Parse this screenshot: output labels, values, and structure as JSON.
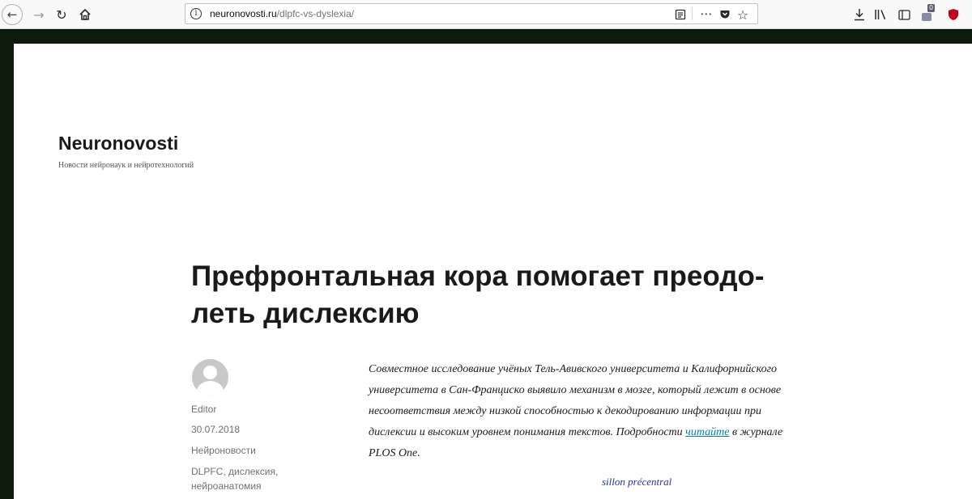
{
  "browser": {
    "url_host": "neuronovosti.ru",
    "url_path": "/dlpfc-vs-dyslexia/",
    "notification_count": "0"
  },
  "site": {
    "title": "Neuronovosti",
    "description": "Новости нейронаук и нейротехнологий"
  },
  "post": {
    "title": "Префронтальная кора помогает преодо-леть дислексию",
    "author": "Editor",
    "date": "30.07.2018",
    "category": "Нейроновости",
    "tags_line1": "DLPFC, дислексия,",
    "tags_line2": "нейроанатомия",
    "excerpt_before_link": "Совместное исследование учёных Тель-Авивского университета и Калифорнийского университета в Сан-Франциско выявило механизм в мозге, который лежит в основе несоответствия между низкой способностью к декодированию информации при дислексии и высоким уровнем понимания текстов. Подробности ",
    "excerpt_link": "читайте",
    "excerpt_after_link": " в журнале PLOS One.",
    "figure_caption": "sillon précentral"
  },
  "colors": {
    "link": "#007acc",
    "frame": "#0b1a0b",
    "ublock": "#c4001a"
  }
}
